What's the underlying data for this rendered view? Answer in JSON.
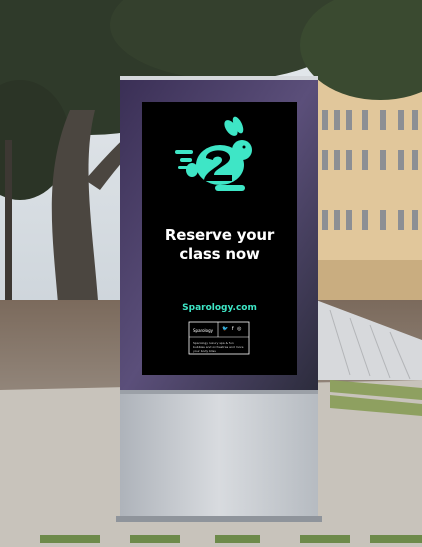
{
  "poster": {
    "headline_line1": "Reserve your",
    "headline_line2": "class now",
    "website": "Sparology.com",
    "card": {
      "brand": "Sparology",
      "social": "🐦 f ◎",
      "body": "Sparology luxury spa & fun bubbles and orchestras and more your body bliss"
    }
  },
  "colors": {
    "accent": "#3ee6c6",
    "screen": "#000000",
    "kiosk": "#c8ccd2"
  },
  "icons": {
    "logo": "rabbit-logo-icon",
    "social": [
      "twitter-icon",
      "facebook-icon",
      "instagram-icon"
    ]
  }
}
